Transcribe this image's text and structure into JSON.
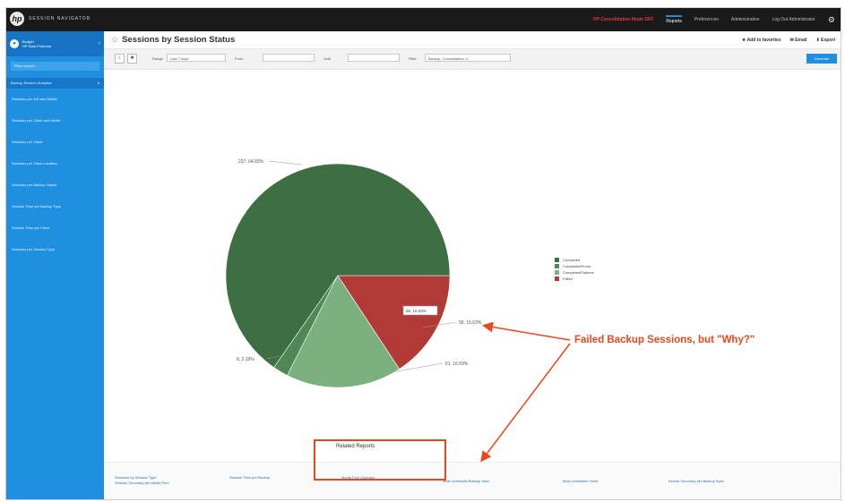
{
  "header": {
    "logo_text": "SESSION NAVIGATOR",
    "alert": "HP Consolidation Mode OFF",
    "nav": [
      "Reports",
      "Preferences",
      "Administration",
      "Log Out Administrator"
    ]
  },
  "sidebar": {
    "user": "Budget",
    "user_sub": "HP Data Protector",
    "search_placeholder": "Filter reports...",
    "group": "Backup Session Analytics",
    "items": [
      "Sessions per Job and Media",
      "Sessions per Client and Media",
      "Sessions per Client",
      "Sessions per Client Location",
      "Sessions per Backup Object",
      "Session Time per Backup Type",
      "Session Time per Client",
      "Sessions per Session Type"
    ]
  },
  "page": {
    "title": "Sessions by Session Status",
    "actions": [
      "Add to favorites",
      "Email",
      "Export"
    ]
  },
  "filters": {
    "range_label": "Range",
    "range_value": "Last 7 days",
    "from_label": "From",
    "until_label": "Until",
    "filter_label": "Filter",
    "filter_value": "Backup, Consolidation, C",
    "generate_label": "Generate"
  },
  "chart_data": {
    "type": "pie",
    "slices": [
      {
        "name": "Completed",
        "label": "237, 64.83%",
        "value": 64.83,
        "color": "#3d6f43"
      },
      {
        "name": "Completed/Errors",
        "label": "8, 2.19%",
        "value": 2.19,
        "color": "#4f8756"
      },
      {
        "name": "Completed/Failures",
        "label": "61, 16.59%",
        "value": 16.59,
        "color": "#7bb17e"
      },
      {
        "name": "Failed",
        "label": "58, 15.63%",
        "value": 15.63,
        "color": "#b23a36"
      }
    ],
    "tooltip": "58, 15.63%",
    "legend_position": "right"
  },
  "annotation": "Failed Backup Sessions, but \"Why?\"",
  "related": {
    "title": "Related Reports",
    "links": [
      "Sessions by Session Type",
      "Session Summary per Media Pool",
      "Session Time per Backup",
      "Media Pool Changes",
      "Most Unreliable Backup Spec",
      "Most Unreliable Client",
      "Device Summary per Backup Spec"
    ]
  }
}
